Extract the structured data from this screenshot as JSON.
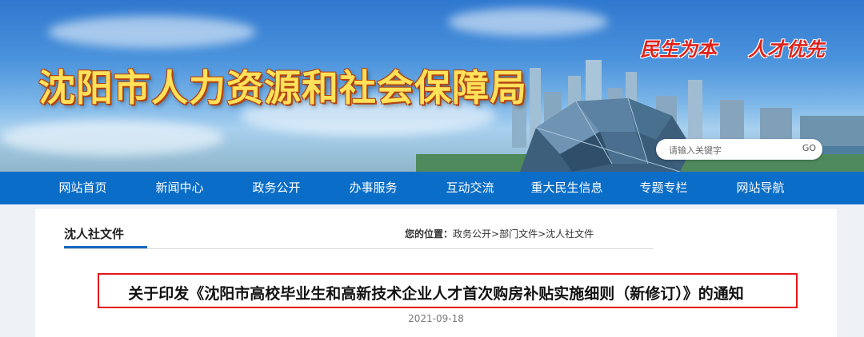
{
  "header": {
    "site_title": "沈阳市人力资源和社会保障局",
    "slogans": [
      "民生为本",
      "人才优先"
    ],
    "search": {
      "placeholder": "请输入关键字",
      "button_label": "GO"
    }
  },
  "nav": {
    "items": [
      "网站首页",
      "新闻中心",
      "政务公开",
      "办事服务",
      "互动交流",
      "重大民生信息",
      "专题专栏",
      "网站导航"
    ]
  },
  "content": {
    "section_tab": "沈人社文件",
    "breadcrumb": {
      "label": "您的位置：",
      "items": [
        "政务公开",
        "部门文件",
        "沈人社文件"
      ],
      "separator": ">"
    },
    "article": {
      "title": "关于印发《沈阳市高校毕业生和高新技术企业人才首次购房补贴实施细则（新修订）》的通知",
      "date": "2021-09-18"
    }
  }
}
